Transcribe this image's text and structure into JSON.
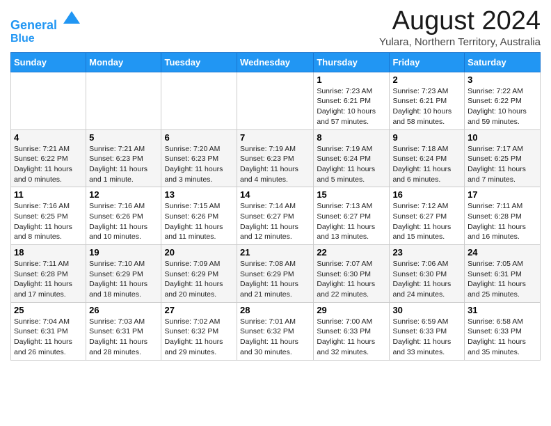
{
  "header": {
    "logo_line1": "General",
    "logo_line2": "Blue",
    "main_title": "August 2024",
    "subtitle": "Yulara, Northern Territory, Australia"
  },
  "days_of_week": [
    "Sunday",
    "Monday",
    "Tuesday",
    "Wednesday",
    "Thursday",
    "Friday",
    "Saturday"
  ],
  "weeks": [
    [
      {
        "day": "",
        "sunrise": "",
        "sunset": "",
        "daylight": ""
      },
      {
        "day": "",
        "sunrise": "",
        "sunset": "",
        "daylight": ""
      },
      {
        "day": "",
        "sunrise": "",
        "sunset": "",
        "daylight": ""
      },
      {
        "day": "",
        "sunrise": "",
        "sunset": "",
        "daylight": ""
      },
      {
        "day": "1",
        "sunrise": "7:23 AM",
        "sunset": "6:21 PM",
        "daylight": "10 hours and 57 minutes."
      },
      {
        "day": "2",
        "sunrise": "7:23 AM",
        "sunset": "6:21 PM",
        "daylight": "10 hours and 58 minutes."
      },
      {
        "day": "3",
        "sunrise": "7:22 AM",
        "sunset": "6:22 PM",
        "daylight": "10 hours and 59 minutes."
      }
    ],
    [
      {
        "day": "4",
        "sunrise": "7:21 AM",
        "sunset": "6:22 PM",
        "daylight": "11 hours and 0 minutes."
      },
      {
        "day": "5",
        "sunrise": "7:21 AM",
        "sunset": "6:23 PM",
        "daylight": "11 hours and 1 minute."
      },
      {
        "day": "6",
        "sunrise": "7:20 AM",
        "sunset": "6:23 PM",
        "daylight": "11 hours and 3 minutes."
      },
      {
        "day": "7",
        "sunrise": "7:19 AM",
        "sunset": "6:23 PM",
        "daylight": "11 hours and 4 minutes."
      },
      {
        "day": "8",
        "sunrise": "7:19 AM",
        "sunset": "6:24 PM",
        "daylight": "11 hours and 5 minutes."
      },
      {
        "day": "9",
        "sunrise": "7:18 AM",
        "sunset": "6:24 PM",
        "daylight": "11 hours and 6 minutes."
      },
      {
        "day": "10",
        "sunrise": "7:17 AM",
        "sunset": "6:25 PM",
        "daylight": "11 hours and 7 minutes."
      }
    ],
    [
      {
        "day": "11",
        "sunrise": "7:16 AM",
        "sunset": "6:25 PM",
        "daylight": "11 hours and 8 minutes."
      },
      {
        "day": "12",
        "sunrise": "7:16 AM",
        "sunset": "6:26 PM",
        "daylight": "11 hours and 10 minutes."
      },
      {
        "day": "13",
        "sunrise": "7:15 AM",
        "sunset": "6:26 PM",
        "daylight": "11 hours and 11 minutes."
      },
      {
        "day": "14",
        "sunrise": "7:14 AM",
        "sunset": "6:27 PM",
        "daylight": "11 hours and 12 minutes."
      },
      {
        "day": "15",
        "sunrise": "7:13 AM",
        "sunset": "6:27 PM",
        "daylight": "11 hours and 13 minutes."
      },
      {
        "day": "16",
        "sunrise": "7:12 AM",
        "sunset": "6:27 PM",
        "daylight": "11 hours and 15 minutes."
      },
      {
        "day": "17",
        "sunrise": "7:11 AM",
        "sunset": "6:28 PM",
        "daylight": "11 hours and 16 minutes."
      }
    ],
    [
      {
        "day": "18",
        "sunrise": "7:11 AM",
        "sunset": "6:28 PM",
        "daylight": "11 hours and 17 minutes."
      },
      {
        "day": "19",
        "sunrise": "7:10 AM",
        "sunset": "6:29 PM",
        "daylight": "11 hours and 18 minutes."
      },
      {
        "day": "20",
        "sunrise": "7:09 AM",
        "sunset": "6:29 PM",
        "daylight": "11 hours and 20 minutes."
      },
      {
        "day": "21",
        "sunrise": "7:08 AM",
        "sunset": "6:29 PM",
        "daylight": "11 hours and 21 minutes."
      },
      {
        "day": "22",
        "sunrise": "7:07 AM",
        "sunset": "6:30 PM",
        "daylight": "11 hours and 22 minutes."
      },
      {
        "day": "23",
        "sunrise": "7:06 AM",
        "sunset": "6:30 PM",
        "daylight": "11 hours and 24 minutes."
      },
      {
        "day": "24",
        "sunrise": "7:05 AM",
        "sunset": "6:31 PM",
        "daylight": "11 hours and 25 minutes."
      }
    ],
    [
      {
        "day": "25",
        "sunrise": "7:04 AM",
        "sunset": "6:31 PM",
        "daylight": "11 hours and 26 minutes."
      },
      {
        "day": "26",
        "sunrise": "7:03 AM",
        "sunset": "6:31 PM",
        "daylight": "11 hours and 28 minutes."
      },
      {
        "day": "27",
        "sunrise": "7:02 AM",
        "sunset": "6:32 PM",
        "daylight": "11 hours and 29 minutes."
      },
      {
        "day": "28",
        "sunrise": "7:01 AM",
        "sunset": "6:32 PM",
        "daylight": "11 hours and 30 minutes."
      },
      {
        "day": "29",
        "sunrise": "7:00 AM",
        "sunset": "6:33 PM",
        "daylight": "11 hours and 32 minutes."
      },
      {
        "day": "30",
        "sunrise": "6:59 AM",
        "sunset": "6:33 PM",
        "daylight": "11 hours and 33 minutes."
      },
      {
        "day": "31",
        "sunrise": "6:58 AM",
        "sunset": "6:33 PM",
        "daylight": "11 hours and 35 minutes."
      }
    ]
  ],
  "labels": {
    "sunrise_prefix": "Sunrise: ",
    "sunset_prefix": "Sunset: ",
    "daylight_prefix": "Daylight: "
  }
}
